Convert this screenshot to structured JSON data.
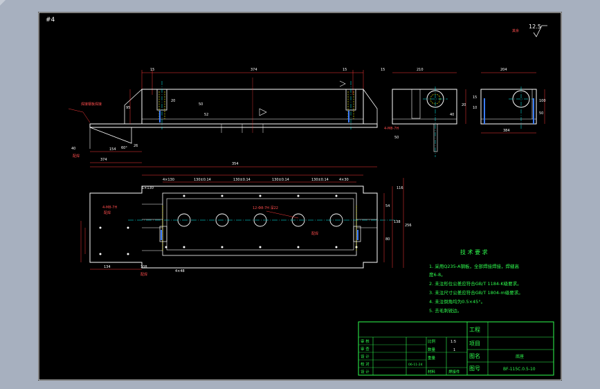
{
  "sheet_number": "#4",
  "roughness": {
    "label": "其余",
    "value": "12.5"
  },
  "front_view": {
    "side_label": "焊接钢板焊接",
    "dims_top": [
      "15",
      "374",
      "15"
    ],
    "dims_vertical": [
      "95",
      "20",
      "50",
      "52"
    ],
    "dims_bottom": [
      "40",
      "154",
      "26"
    ],
    "angle": "60°",
    "small_label": "配焊"
  },
  "side_view_1": {
    "dims": [
      "210",
      "20",
      "40",
      "50",
      "15"
    ],
    "note": "4-M8-7H"
  },
  "side_view_2": {
    "dims": [
      "204",
      "100",
      "50",
      "10",
      "15",
      "384"
    ]
  },
  "plan_view": {
    "overall": [
      "374",
      "354",
      "374"
    ],
    "spacing": [
      "4×130",
      "1×130",
      "130±0.14",
      "130±0.14",
      "130±0.14",
      "130±0.14",
      "4×30"
    ],
    "hole_note": "12-Φ8-7H  深22",
    "left_note": "4-M8-7H",
    "left_label": "配焊",
    "right_dims": [
      "54",
      "138",
      "80",
      "116",
      "256"
    ],
    "bottom_dims": [
      "134",
      "108",
      "4×48"
    ],
    "bottom_label": "配焊",
    "mid_label": "配焊"
  },
  "requirements": {
    "title": "技 术 要 求",
    "items": [
      "1. 采用Q235-A钢板，全部焊接焊接，焊缝高",
      "度6-8。",
      "2. 未注形位公差应符合GB/T 1184-K级要求。",
      "3. 未注尺寸公差应符合GB/T 1804-m级要求。",
      "4. 未注倒角均为0.5×45°。",
      "5. 去毛刺锐边。"
    ]
  },
  "title_block": {
    "left_rows": [
      {
        "role": "审 核",
        "name": "",
        "date": ""
      },
      {
        "role": "审 查",
        "name": "",
        "date": ""
      },
      {
        "role": "设 计",
        "name": "",
        "date": ""
      },
      {
        "role": "校 对",
        "name": "06-11-24",
        "date": ""
      },
      {
        "role": "设 计",
        "name": "",
        "date": ""
      }
    ],
    "mid": {
      "scale_label": "比例",
      "scale_value": "1:5",
      "qty_label": "数量",
      "qty_value": "1",
      "weight_label": "重量",
      "weight_value": "",
      "material_label": "材料",
      "material_value": "焊接件"
    },
    "right": {
      "project_label": "工程",
      "item_label": "项目",
      "drawing_name_label": "图名",
      "drawing_name": "底座",
      "drawing_no_label": "图号",
      "drawing_no": "BF-115C.0.5-10"
    }
  },
  "colors": {
    "background": "#000000",
    "outline": "#ffffff",
    "dimension": "#ff3b3b",
    "hidden": "#ffff00",
    "centerline": "#00ffff",
    "text_green": "#2fff4f",
    "section": "#3b7cff"
  }
}
